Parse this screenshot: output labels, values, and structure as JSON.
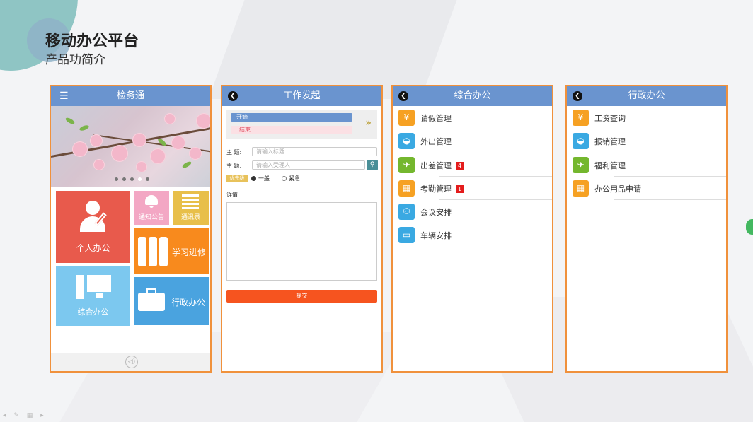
{
  "page": {
    "title": "移动办公平台",
    "subtitle": "产品功简介"
  },
  "phone1": {
    "header": "检务通",
    "menu_icon": "hamburger-icon",
    "tiles": [
      {
        "label": "个人办公",
        "icon": "person-pen-icon",
        "color": "#e85a4c"
      },
      {
        "label": "通知公告",
        "icon": "bell-icon",
        "color": "#f3a7c4"
      },
      {
        "label": "通讯录",
        "icon": "list-icon",
        "color": "#e8bf4a"
      },
      {
        "label": "学习进修",
        "icon": "books-icon",
        "color": "#f88a1d"
      },
      {
        "label": "综合办公",
        "icon": "computer-icon",
        "color": "#7cc8ef"
      },
      {
        "label": "行政办公",
        "icon": "toolbox-icon",
        "color": "#4aa3df"
      }
    ]
  },
  "phone2": {
    "header": "工作发起",
    "tab_start": "开始",
    "tab_end": "结束",
    "subject_label": "主 题:",
    "subject_placeholder": "请输入标题",
    "assignee_label": "主 题:",
    "assignee_placeholder": "请输入受理人",
    "priority_label": "优先级",
    "priority_normal": "一般",
    "priority_urgent": "紧急",
    "detail_label": "详情",
    "submit": "提交"
  },
  "phone3": {
    "header": "综合办公",
    "items": [
      {
        "label": "请假管理",
        "icon": "money-icon",
        "color": "#f6a123",
        "badge": ""
      },
      {
        "label": "外出管理",
        "icon": "car-icon",
        "color": "#3aa9e2",
        "badge": ""
      },
      {
        "label": "出差管理",
        "icon": "airplane-icon",
        "color": "#74b72e",
        "badge": "4"
      },
      {
        "label": "考勤管理",
        "icon": "calendar-icon",
        "color": "#f6a123",
        "badge": "1"
      },
      {
        "label": "会议安排",
        "icon": "meeting-icon",
        "color": "#3aa9e2",
        "badge": ""
      },
      {
        "label": "车辆安排",
        "icon": "bus-icon",
        "color": "#3aa9e2",
        "badge": ""
      }
    ]
  },
  "phone4": {
    "header": "行政办公",
    "items": [
      {
        "label": "工资查询",
        "icon": "money-icon",
        "color": "#f6a123"
      },
      {
        "label": "报销管理",
        "icon": "car-icon",
        "color": "#3aa9e2"
      },
      {
        "label": "福利管理",
        "icon": "airplane-icon",
        "color": "#74b72e"
      },
      {
        "label": "办公用品申请",
        "icon": "calendar-icon",
        "color": "#f6a123"
      }
    ]
  }
}
